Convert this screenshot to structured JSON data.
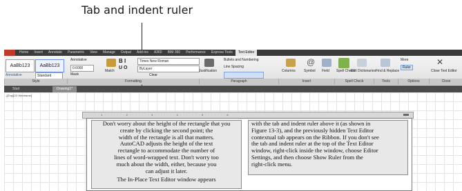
{
  "callout": "Tab and indent ruler",
  "ribbon": {
    "tabs": [
      "Home",
      "Insert",
      "Annotate",
      "Parametric",
      "View",
      "Manage",
      "Output",
      "Add-ins",
      "A360",
      "BIM 360",
      "Performance",
      "Express Tools",
      "Text Editor"
    ],
    "active_tab": "Text Editor",
    "style_samples": [
      "AaBb123",
      "AaBb123"
    ],
    "annotative": "Annotative",
    "standard": "Standard",
    "height": "0.6000",
    "mask": "Mask",
    "match": "Match",
    "font": "Times New Roman",
    "bylayer": "ByLayer",
    "clear": "Clear",
    "justification": "Justification",
    "bullets": "Bullets and Numbering",
    "line_spacing": "Line Spacing",
    "columns": "Columns",
    "symbol": "Symbol",
    "field": "Field",
    "spell_check": "Spell Check",
    "edit_dict": "Edit Dictionaries",
    "find_replace": "Find & Replace",
    "more": "More",
    "ruler": "Ruler",
    "close": "Close Text Editor",
    "panels": [
      "Style",
      "Formatting",
      "Paragraph",
      "Insert",
      "Spell Check",
      "Tools",
      "Options",
      "Close"
    ]
  },
  "doc_tabs": [
    "Start",
    "Drawing1*"
  ],
  "viewport_label": "-][Top][2D Wireframe]",
  "column1": [
    "Don't worry about the height of the rectangle that you",
    "create by clicking the second point; the",
    "width of the rectangle is all that matters.",
    "AutoCAD adjusts the height of the text",
    "rectangle to accommodate the number of",
    "lines of word-wrapped text. Don't worry too",
    "much about the width, either, because you",
    "can adjust it later.",
    "The In-Place Text Editor window appears"
  ],
  "column2": [
    "with the tab and indent ruler above it (as shown in",
    "Figure 13-3), and the previously hidden Text Editor",
    "contextual tab appears on the Ribbon. If you don't see",
    "the tab and indent ruler at the top of the Text Editor",
    "window, right-click inside the window, choose Editor",
    "Settings, and then choose Show Ruler from the",
    "right-click menu."
  ]
}
